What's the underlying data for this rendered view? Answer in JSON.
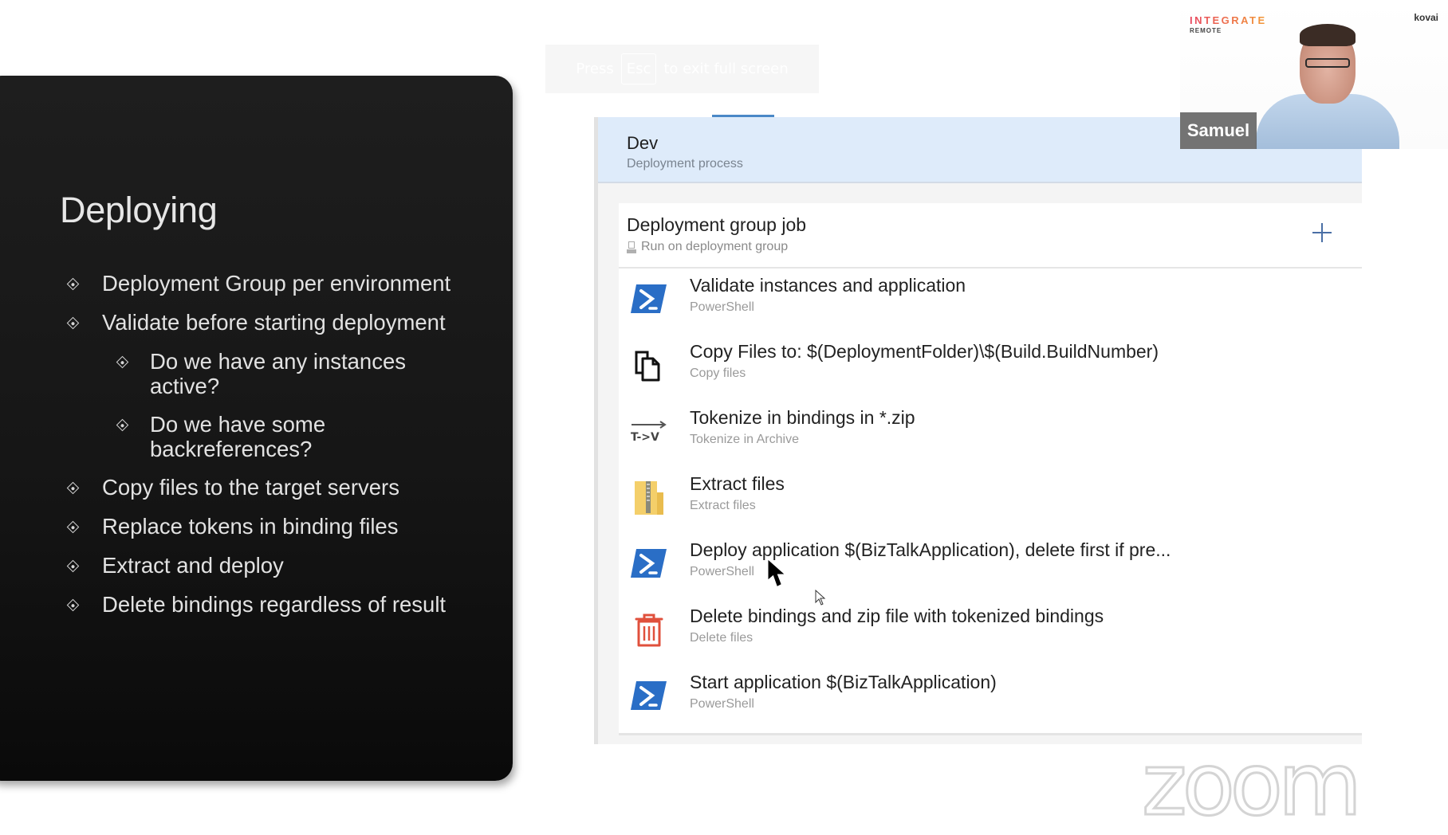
{
  "slide": {
    "title": "Deploying",
    "bullets": [
      {
        "text": "Deployment Group per environment",
        "level": 1
      },
      {
        "text": "Validate before starting deployment",
        "level": 1
      },
      {
        "text": "Do we have any instances active?",
        "level": 2
      },
      {
        "text": "Do we have some backreferences?",
        "level": 2
      },
      {
        "text": "Copy files to the target servers",
        "level": 1
      },
      {
        "text": "Replace tokens in binding files",
        "level": 1
      },
      {
        "text": "Extract and deploy",
        "level": 1
      },
      {
        "text": "Delete bindings regardless of result",
        "level": 1
      }
    ]
  },
  "toast": {
    "prefix": "Press",
    "key": "Esc",
    "suffix": "to exit full screen"
  },
  "pipeline": {
    "stage": {
      "title": "Dev",
      "subtitle": "Deployment process"
    },
    "job": {
      "title": "Deployment group job",
      "subtitle": "Run on deployment group",
      "add_label": "+"
    },
    "tasks": [
      {
        "title": "Validate instances and application",
        "type": "PowerShell",
        "icon": "powershell-icon"
      },
      {
        "title": "Copy Files to: $(DeploymentFolder)\\$(Build.BuildNumber)",
        "type": "Copy files",
        "icon": "copy-files-icon"
      },
      {
        "title": "Tokenize in bindings in *.zip",
        "type": "Tokenize in Archive",
        "icon": "tokenize-icon"
      },
      {
        "title": "Extract files",
        "type": "Extract files",
        "icon": "zip-folder-icon"
      },
      {
        "title": "Deploy application $(BizTalkApplication), delete first if pre...",
        "type": "PowerShell",
        "icon": "powershell-icon"
      },
      {
        "title": "Delete bindings and zip file with tokenized bindings",
        "type": "Delete files",
        "icon": "trash-icon"
      },
      {
        "title": "Start application $(BizTalkApplication)",
        "type": "PowerShell",
        "icon": "powershell-icon"
      }
    ]
  },
  "video": {
    "participant_name": "Samuel",
    "brand_line1": "INTEGRATE",
    "brand_line2": "REMOTE",
    "brand_sponsor": "kovai"
  },
  "watermark": "zoom",
  "colors": {
    "accent_blue": "#4a88c7",
    "stage_header_bg": "#deebfa",
    "powershell_blue": "#2a6ec6",
    "trash_red": "#e0503c",
    "zip_yellow": "#f4cf6a"
  }
}
